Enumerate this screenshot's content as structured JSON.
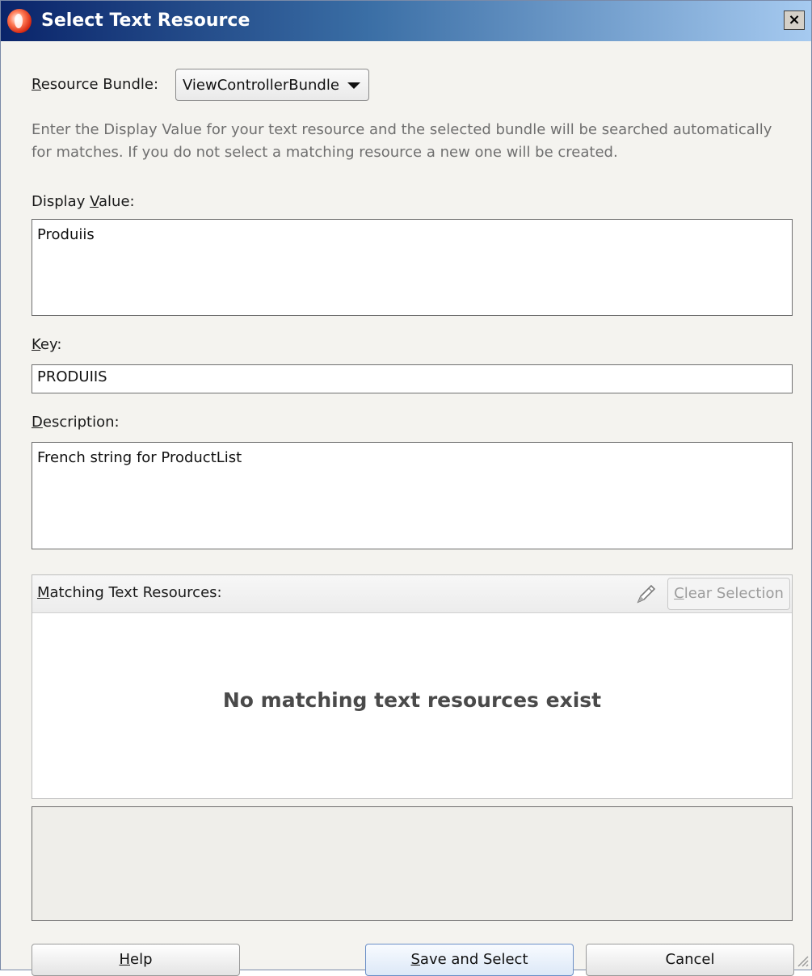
{
  "window": {
    "title": "Select Text Resource",
    "close_label": "×",
    "icon": "jdeveloper-app-icon"
  },
  "resource_bundle": {
    "label_underlined": "R",
    "label_rest": "esource Bundle:",
    "value": "ViewControllerBundle"
  },
  "info_text": "Enter the Display Value for your text resource and the selected bundle will be searched automatically for matches.  If you do not select a matching resource a new one will be created.",
  "display_value": {
    "label_before": "Display ",
    "label_underlined": "V",
    "label_after": "alue:",
    "value": "Produiis"
  },
  "key": {
    "label_underlined": "K",
    "label_rest": "ey:",
    "value": "PRODUIIS"
  },
  "description": {
    "label_underlined": "D",
    "label_rest": "escription:",
    "value": "French string for ProductList"
  },
  "matching": {
    "label_underlined": "M",
    "label_rest": "atching Text Resources:",
    "edit_icon": "pencil-icon",
    "clear_underlined": "C",
    "clear_rest": "lear Selection",
    "empty_message": "No matching text resources exist"
  },
  "buttons": {
    "help_underlined": "H",
    "help_rest": "elp",
    "save_underlined": "S",
    "save_rest": "ave and Select",
    "cancel": "Cancel"
  },
  "colors": {
    "title_gradient_start": "#0a246a",
    "title_gradient_end": "#a6caf0",
    "dialog_bg": "#f4f3ef"
  }
}
